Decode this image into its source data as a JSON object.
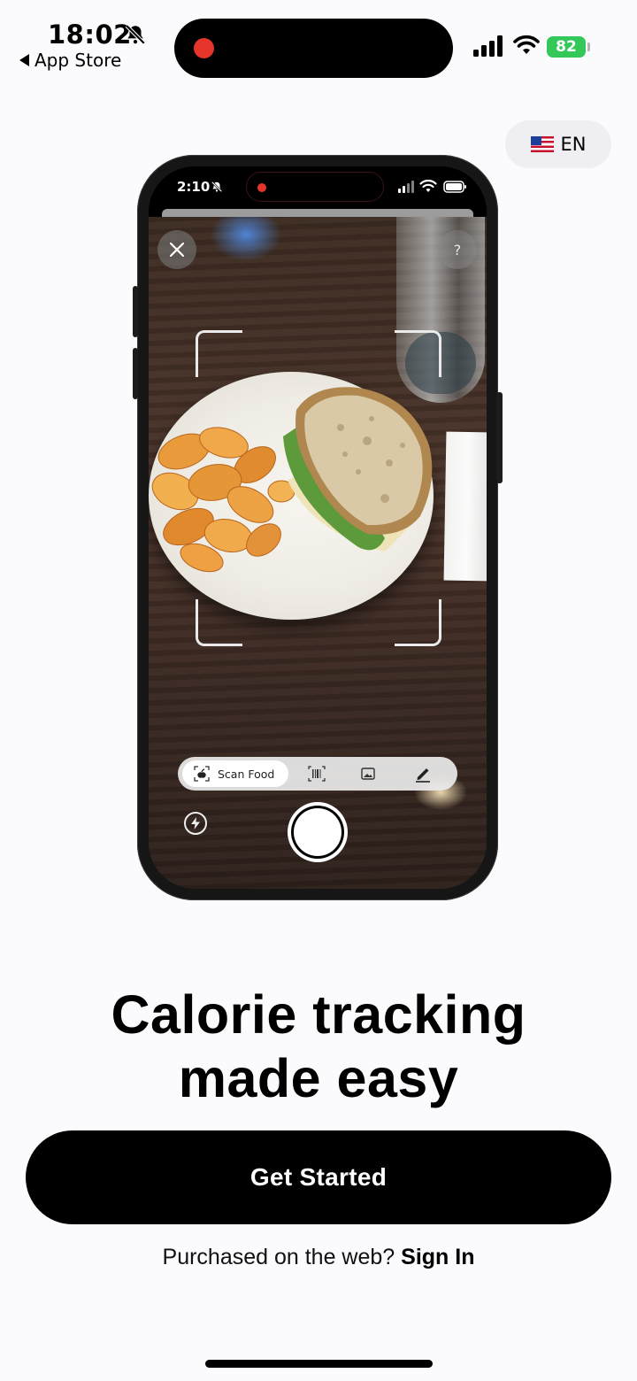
{
  "status_bar": {
    "time": "18:02",
    "back_label": "App Store",
    "battery": "82"
  },
  "language": {
    "code": "EN",
    "flag_icon": "us-flag-icon"
  },
  "mockup": {
    "status_time": "2:10",
    "mode_active_label": "Scan Food",
    "mode_icons": [
      "apple-icon",
      "barcode-icon",
      "image-icon",
      "pencil-icon"
    ]
  },
  "headline": {
    "line1": "Calorie tracking",
    "line2": "made easy"
  },
  "cta": {
    "label": "Get Started"
  },
  "signin": {
    "prompt": "Purchased on the web?",
    "link": "Sign In"
  },
  "colors": {
    "background": "#fbfafd",
    "cta_background": "#000000",
    "battery": "#34c759",
    "record_dot": "#e5342a"
  }
}
